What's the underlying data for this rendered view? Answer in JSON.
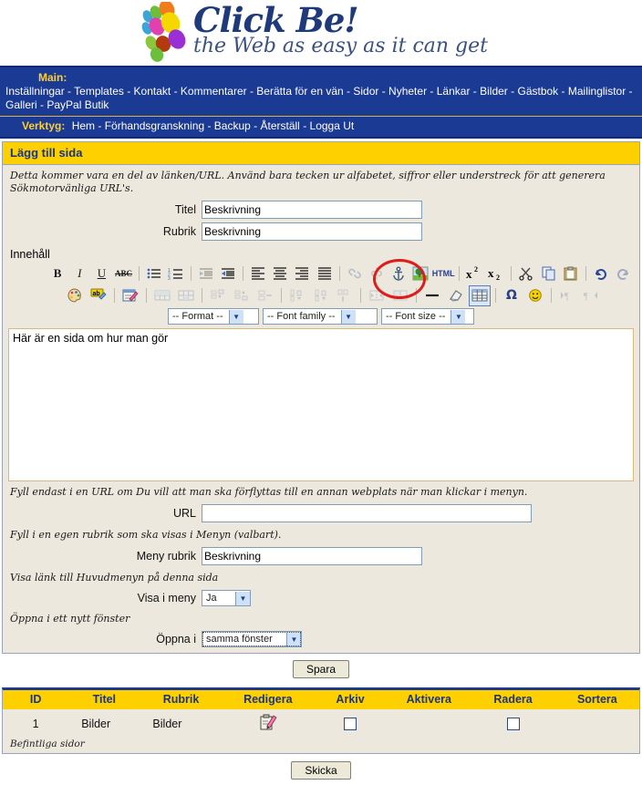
{
  "logo": {
    "title": "Click Be!",
    "tagline": "the Web as easy as it can get",
    "dot_colors": [
      "#f07c1e",
      "#3ba5d8",
      "#6cbf3a",
      "#f5d800",
      "#7d2fa8",
      "#e040b0",
      "#b23a0c",
      "#9b2fd6",
      "#8bc63e",
      "#c24a10"
    ]
  },
  "nav": {
    "main_label": "Main:",
    "main_items": [
      "Inställningar",
      "Templates",
      "Kontakt",
      "Kommentarer",
      "Berätta för en vän",
      "Sidor",
      "Nyheter",
      "Länkar",
      "Bilder",
      "Gästbok",
      "Mailinglistor",
      "Galleri",
      "PayPal Butik"
    ],
    "tools_label": "Verktyg:",
    "tools_items": [
      "Hem",
      "Förhandsgranskning",
      "Backup",
      "Återställ",
      "Logga Ut"
    ],
    "bg_color": "#1a3a93",
    "label_color": "#ffd02e"
  },
  "panel": {
    "heading": "Lägg till sida",
    "hint_url": "Detta kommer vara en del av länken/URL. Använd bara tecken ur alfabetet, siffror eller understreck för att generera Sökmotorvänliga URL's.",
    "fields": {
      "titel_label": "Titel",
      "titel_value": "Beskrivning",
      "rubrik_label": "Rubrik",
      "rubrik_value": "Beskrivning"
    },
    "content_label": "Innehåll",
    "editor_text": "Här är en sida om hur man gör",
    "hint_link": "Fyll endast i en URL om Du vill att man ska förflyttas till en annan webplats när man klickar i menyn.",
    "url_label": "URL",
    "url_value": "",
    "hint_menu": "Fyll i en egen rubrik som ska visas i Menyn (valbart).",
    "menu_rubrik_label": "Meny rubrik",
    "menu_rubrik_value": "Beskrivning",
    "hint_show": "Visa länk till Huvudmenyn på denna sida",
    "show_label": "Visa i meny",
    "show_value": "Ja",
    "hint_window": "Öppna i ett nytt fönster",
    "open_label": "Öppna i",
    "open_value": "samma fönster",
    "save_button": "Spara"
  },
  "toolbar": {
    "format_select": "-- Format --",
    "fontfamily_select": "-- Font family --",
    "fontsize_select": "-- Font size --",
    "row1": [
      {
        "name": "bold-icon",
        "glyph": "B",
        "cls": "glyph-b",
        "dim": false
      },
      {
        "name": "italic-icon",
        "glyph": "I",
        "cls": "glyph-i",
        "dim": false
      },
      {
        "name": "underline-icon",
        "glyph": "U",
        "cls": "glyph-u",
        "dim": false
      },
      {
        "name": "strikethrough-icon",
        "glyph": "ABC",
        "cls": "glyph-s",
        "dim": false
      },
      {
        "name": "separator",
        "glyph": "|",
        "cls": "sep",
        "dim": false
      },
      {
        "name": "bullet-list-icon",
        "glyph": "",
        "cls": "ico-ul",
        "dim": false
      },
      {
        "name": "numbered-list-icon",
        "glyph": "",
        "cls": "ico-ol",
        "dim": false
      },
      {
        "name": "separator",
        "glyph": "|",
        "cls": "sep",
        "dim": false
      },
      {
        "name": "outdent-icon",
        "glyph": "",
        "cls": "ico-outdent",
        "dim": true
      },
      {
        "name": "indent-icon",
        "glyph": "",
        "cls": "ico-indent",
        "dim": false
      },
      {
        "name": "separator",
        "glyph": "|",
        "cls": "sep",
        "dim": false
      },
      {
        "name": "align-left-icon",
        "glyph": "",
        "cls": "ico-alignl",
        "dim": false
      },
      {
        "name": "align-center-icon",
        "glyph": "",
        "cls": "ico-alignc",
        "dim": false
      },
      {
        "name": "align-right-icon",
        "glyph": "",
        "cls": "ico-alignr",
        "dim": false
      },
      {
        "name": "align-justify-icon",
        "glyph": "",
        "cls": "ico-alignj",
        "dim": false
      },
      {
        "name": "separator",
        "glyph": "|",
        "cls": "sep",
        "dim": false
      },
      {
        "name": "insert-link-icon",
        "glyph": "",
        "cls": "ico-link",
        "dim": true
      },
      {
        "name": "unlink-icon",
        "glyph": "",
        "cls": "ico-unlink",
        "dim": true
      },
      {
        "name": "anchor-icon",
        "glyph": "",
        "cls": "ico-anchor",
        "dim": false
      },
      {
        "name": "insert-image-icon",
        "glyph": "",
        "cls": "ico-image",
        "dim": false
      },
      {
        "name": "edit-html-icon",
        "glyph": "HTML",
        "cls": "html-lbl",
        "dim": false
      },
      {
        "name": "separator",
        "glyph": "|",
        "cls": "sep",
        "dim": false
      },
      {
        "name": "superscript-icon",
        "glyph": "x2",
        "cls": "ico-sup",
        "dim": false
      },
      {
        "name": "subscript-icon",
        "glyph": "x2",
        "cls": "ico-sub",
        "dim": false
      },
      {
        "name": "separator",
        "glyph": "|",
        "cls": "sep",
        "dim": false
      },
      {
        "name": "cut-icon",
        "glyph": "",
        "cls": "ico-cut",
        "dim": false
      },
      {
        "name": "copy-icon",
        "glyph": "",
        "cls": "ico-copy",
        "dim": false
      },
      {
        "name": "paste-icon",
        "glyph": "",
        "cls": "ico-paste",
        "dim": false
      },
      {
        "name": "separator",
        "glyph": "|",
        "cls": "sep",
        "dim": false
      },
      {
        "name": "undo-icon",
        "glyph": "",
        "cls": "ico-undo",
        "dim": false
      },
      {
        "name": "redo-icon",
        "glyph": "",
        "cls": "ico-redo",
        "dim": true
      }
    ],
    "row2": [
      {
        "name": "text-color-icon",
        "glyph": "",
        "cls": "ico-palette",
        "dim": false
      },
      {
        "name": "background-color-icon",
        "glyph": "",
        "cls": "ico-hilite",
        "dim": false
      },
      {
        "name": "separator",
        "glyph": "|",
        "cls": "sep",
        "dim": false
      },
      {
        "name": "edit-css-icon",
        "glyph": "",
        "cls": "ico-cssedit",
        "dim": false
      },
      {
        "name": "separator",
        "glyph": "|",
        "cls": "sep",
        "dim": false
      },
      {
        "name": "table-row-props-icon",
        "glyph": "",
        "cls": "ico-trow",
        "dim": true
      },
      {
        "name": "table-cell-props-icon",
        "glyph": "",
        "cls": "ico-tcell",
        "dim": true
      },
      {
        "name": "separator",
        "glyph": "|",
        "cls": "sep",
        "dim": false
      },
      {
        "name": "insert-row-before-icon",
        "glyph": "",
        "cls": "ico-rowbefore",
        "dim": true
      },
      {
        "name": "insert-row-after-icon",
        "glyph": "",
        "cls": "ico-rowafter",
        "dim": true
      },
      {
        "name": "delete-row-icon",
        "glyph": "",
        "cls": "ico-rowdel",
        "dim": true
      },
      {
        "name": "separator",
        "glyph": "|",
        "cls": "sep",
        "dim": false
      },
      {
        "name": "insert-column-before-icon",
        "glyph": "",
        "cls": "ico-colbefore",
        "dim": true
      },
      {
        "name": "insert-column-after-icon",
        "glyph": "",
        "cls": "ico-colafter",
        "dim": true
      },
      {
        "name": "delete-column-icon",
        "glyph": "",
        "cls": "ico-coldel",
        "dim": true
      },
      {
        "name": "separator",
        "glyph": "|",
        "cls": "sep",
        "dim": false
      },
      {
        "name": "split-cells-icon",
        "glyph": "",
        "cls": "ico-split",
        "dim": true
      },
      {
        "name": "merge-cells-icon",
        "glyph": "",
        "cls": "ico-merge",
        "dim": true
      },
      {
        "name": "separator",
        "glyph": "|",
        "cls": "sep",
        "dim": false
      },
      {
        "name": "horizontal-rule-icon",
        "glyph": "",
        "cls": "ico-hr",
        "dim": false
      },
      {
        "name": "remove-format-icon",
        "glyph": "",
        "cls": "ico-eraser",
        "dim": false
      },
      {
        "name": "insert-table-icon",
        "glyph": "",
        "cls": "ico-table",
        "dim": false,
        "selected": true
      },
      {
        "name": "separator",
        "glyph": "|",
        "cls": "sep",
        "dim": false
      },
      {
        "name": "special-character-icon",
        "glyph": "Ω",
        "cls": "omega",
        "dim": false
      },
      {
        "name": "emoticon-icon",
        "glyph": "",
        "cls": "ico-smiley",
        "dim": false
      },
      {
        "name": "separator",
        "glyph": "|",
        "cls": "sep",
        "dim": false
      },
      {
        "name": "direction-ltr-icon",
        "glyph": "",
        "cls": "ico-ltr",
        "dim": true
      },
      {
        "name": "direction-rtl-icon",
        "glyph": "",
        "cls": "ico-rtl",
        "dim": true
      }
    ]
  },
  "table": {
    "headers": [
      "ID",
      "Titel",
      "Rubrik",
      "Redigera",
      "Arkiv",
      "Aktivera",
      "Radera",
      "Sortera"
    ],
    "rows": [
      {
        "id": "1",
        "titel": "Bilder",
        "rubrik": "Bilder",
        "redigera": "edit-icon",
        "arkiv": "checkbox",
        "aktivera": "",
        "radera": "checkbox",
        "sortera": ""
      }
    ],
    "note": "Befintliga sidor",
    "submit_button": "Skicka"
  },
  "annotation": {
    "type": "red-ellipse-highlight",
    "target": "insert-image-icon",
    "color": "#e01b1b"
  }
}
